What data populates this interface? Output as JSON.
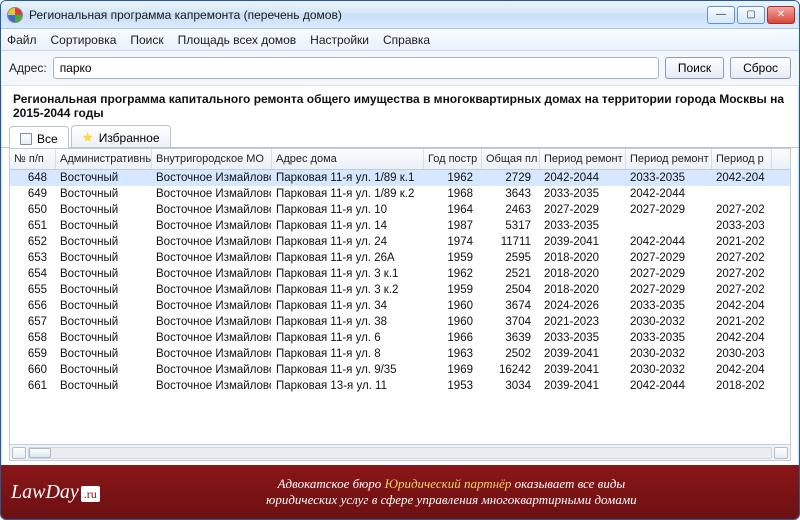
{
  "window": {
    "title": "Региональная программа капремонта (перечень домов)"
  },
  "menu": {
    "file": "Файл",
    "sort": "Сортировка",
    "search": "Поиск",
    "area": "Площадь всех домов",
    "settings": "Настройки",
    "help": "Справка"
  },
  "address_row": {
    "label": "Адрес:",
    "value": "парко",
    "search_btn": "Поиск",
    "reset_btn": "Сброс"
  },
  "heading": "Региональная программа капитального ремонта общего имущества в многоквартирных домах на территории города Москвы на 2015-2044 годы",
  "tabs": {
    "all": "Все",
    "fav": "Избранное"
  },
  "columns": {
    "idx": "№ п/п",
    "district": "Административный",
    "mo": "Внутригородское МО",
    "addr": "Адрес дома",
    "year": "Год постр",
    "area": "Общая пл",
    "p1": "Период ремонт",
    "p2": "Период ремонт",
    "p3": "Период р"
  },
  "rows": [
    {
      "idx": 648,
      "district": "Восточный",
      "mo": "Восточное Измайлово",
      "addr": "Парковая 11-я ул. 1/89 к.1",
      "year": 1962,
      "area": 2729,
      "p1": "2042-2044",
      "p2": "2033-2035",
      "p3": "2042-204"
    },
    {
      "idx": 649,
      "district": "Восточный",
      "mo": "Восточное Измайлово",
      "addr": "Парковая 11-я ул. 1/89 к.2",
      "year": 1968,
      "area": 3643,
      "p1": "2033-2035",
      "p2": "2042-2044",
      "p3": ""
    },
    {
      "idx": 650,
      "district": "Восточный",
      "mo": "Восточное Измайлово",
      "addr": "Парковая 11-я ул. 10",
      "year": 1964,
      "area": 2463,
      "p1": "2027-2029",
      "p2": "2027-2029",
      "p3": "2027-202"
    },
    {
      "idx": 651,
      "district": "Восточный",
      "mo": "Восточное Измайлово",
      "addr": "Парковая 11-я ул. 14",
      "year": 1987,
      "area": 5317,
      "p1": "2033-2035",
      "p2": "",
      "p3": "2033-203"
    },
    {
      "idx": 652,
      "district": "Восточный",
      "mo": "Восточное Измайлово",
      "addr": "Парковая 11-я ул. 24",
      "year": 1974,
      "area": 11711,
      "p1": "2039-2041",
      "p2": "2042-2044",
      "p3": "2021-202"
    },
    {
      "idx": 653,
      "district": "Восточный",
      "mo": "Восточное Измайлово",
      "addr": "Парковая 11-я ул. 26А",
      "year": 1959,
      "area": 2595,
      "p1": "2018-2020",
      "p2": "2027-2029",
      "p3": "2027-202"
    },
    {
      "idx": 654,
      "district": "Восточный",
      "mo": "Восточное Измайлово",
      "addr": "Парковая 11-я ул. 3 к.1",
      "year": 1962,
      "area": 2521,
      "p1": "2018-2020",
      "p2": "2027-2029",
      "p3": "2027-202"
    },
    {
      "idx": 655,
      "district": "Восточный",
      "mo": "Восточное Измайлово",
      "addr": "Парковая 11-я ул. 3 к.2",
      "year": 1959,
      "area": 2504,
      "p1": "2018-2020",
      "p2": "2027-2029",
      "p3": "2027-202"
    },
    {
      "idx": 656,
      "district": "Восточный",
      "mo": "Восточное Измайлово",
      "addr": "Парковая 11-я ул. 34",
      "year": 1960,
      "area": 3674,
      "p1": "2024-2026",
      "p2": "2033-2035",
      "p3": "2042-204"
    },
    {
      "idx": 657,
      "district": "Восточный",
      "mo": "Восточное Измайлово",
      "addr": "Парковая 11-я ул. 38",
      "year": 1960,
      "area": 3704,
      "p1": "2021-2023",
      "p2": "2030-2032",
      "p3": "2021-202"
    },
    {
      "idx": 658,
      "district": "Восточный",
      "mo": "Восточное Измайлово",
      "addr": "Парковая 11-я ул. 6",
      "year": 1966,
      "area": 3639,
      "p1": "2033-2035",
      "p2": "2033-2035",
      "p3": "2042-204"
    },
    {
      "idx": 659,
      "district": "Восточный",
      "mo": "Восточное Измайлово",
      "addr": "Парковая 11-я ул. 8",
      "year": 1963,
      "area": 2502,
      "p1": "2039-2041",
      "p2": "2030-2032",
      "p3": "2030-203"
    },
    {
      "idx": 660,
      "district": "Восточный",
      "mo": "Восточное Измайлово",
      "addr": "Парковая 11-я ул. 9/35",
      "year": 1969,
      "area": 16242,
      "p1": "2039-2041",
      "p2": "2030-2032",
      "p3": "2042-204"
    },
    {
      "idx": 661,
      "district": "Восточный",
      "mo": "Восточное Измайлово",
      "addr": "Парковая 13-я ул. 11",
      "year": 1953,
      "area": 3034,
      "p1": "2039-2041",
      "p2": "2042-2044",
      "p3": "2018-202"
    }
  ],
  "banner": {
    "logo_main": "LawDay",
    "logo_suffix": ".ru",
    "line1_a": "Адвокатское бюро ",
    "line1_b": "Юридический партнёр",
    "line1_c": " оказывает все виды",
    "line2": "юридических услуг в сфере управления многоквартирными домами"
  }
}
